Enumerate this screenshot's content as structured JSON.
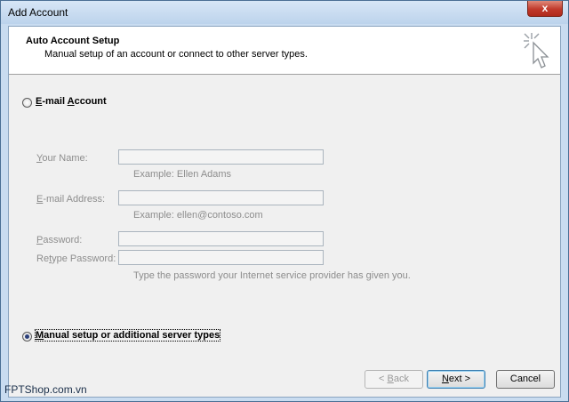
{
  "window": {
    "title": "Add Account",
    "close_glyph": "x"
  },
  "header": {
    "title": "Auto Account Setup",
    "subtitle": "Manual setup of an account or connect to other server types.",
    "icon": "cursor-sparkle-icon"
  },
  "email_option": {
    "label": "E-mail Account",
    "selected": false
  },
  "fields": {
    "name_label": "Your Name:",
    "name_value": "",
    "name_hint": "Example: Ellen Adams",
    "email_label": "E-mail Address:",
    "email_value": "",
    "email_hint": "Example: ellen@contoso.com",
    "password_label": "Password:",
    "password_value": "",
    "retype_label": "Retype Password:",
    "retype_value": "",
    "password_hint": "Type the password your Internet service provider has given you."
  },
  "manual_option": {
    "label": "Manual setup or additional server types",
    "selected": true
  },
  "buttons": {
    "back": "< Back",
    "next": "Next >",
    "cancel": "Cancel"
  },
  "watermark": "FPTShop.com.vn"
}
